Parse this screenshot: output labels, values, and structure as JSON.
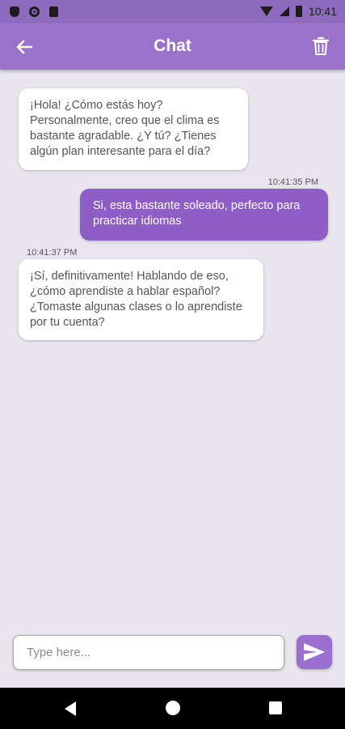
{
  "status_bar": {
    "time": "10:41",
    "icons": [
      "shield-icon",
      "circle-icon",
      "sim-card-icon",
      "wifi-icon",
      "signal-icon",
      "battery-icon"
    ]
  },
  "app_bar": {
    "title": "Chat",
    "back_icon": "arrow-left-icon",
    "delete_icon": "trash-icon"
  },
  "messages": [
    {
      "sender": "bot",
      "text": "¡Hola! ¿Cómo estás hoy? Personalmente, creo que el clima es bastante agradable. ¿Y tú? ¿Tienes algún plan interesante para el día?",
      "time": ""
    },
    {
      "sender": "user",
      "text": "Si, esta bastante soleado, perfecto para practicar idiomas",
      "time": "10:41:35 PM"
    },
    {
      "sender": "bot",
      "text": "¡Sí, definitivamente! Hablando de eso, ¿cómo aprendiste a hablar español? ¿Tomaste algunas clases o lo aprendiste por tu cuenta?",
      "time": "10:41:37 PM"
    }
  ],
  "input": {
    "placeholder": "Type here...",
    "value": ""
  },
  "send_icon": "send-icon",
  "colors": {
    "app_bar": "#9b72c9",
    "status_bar": "#8e6bbe",
    "user_bubble": "#8e5dc6",
    "background": "#e8e5ee"
  },
  "nav_bar": {
    "icons": [
      "nav-back-icon",
      "nav-home-icon",
      "nav-recent-icon"
    ]
  }
}
